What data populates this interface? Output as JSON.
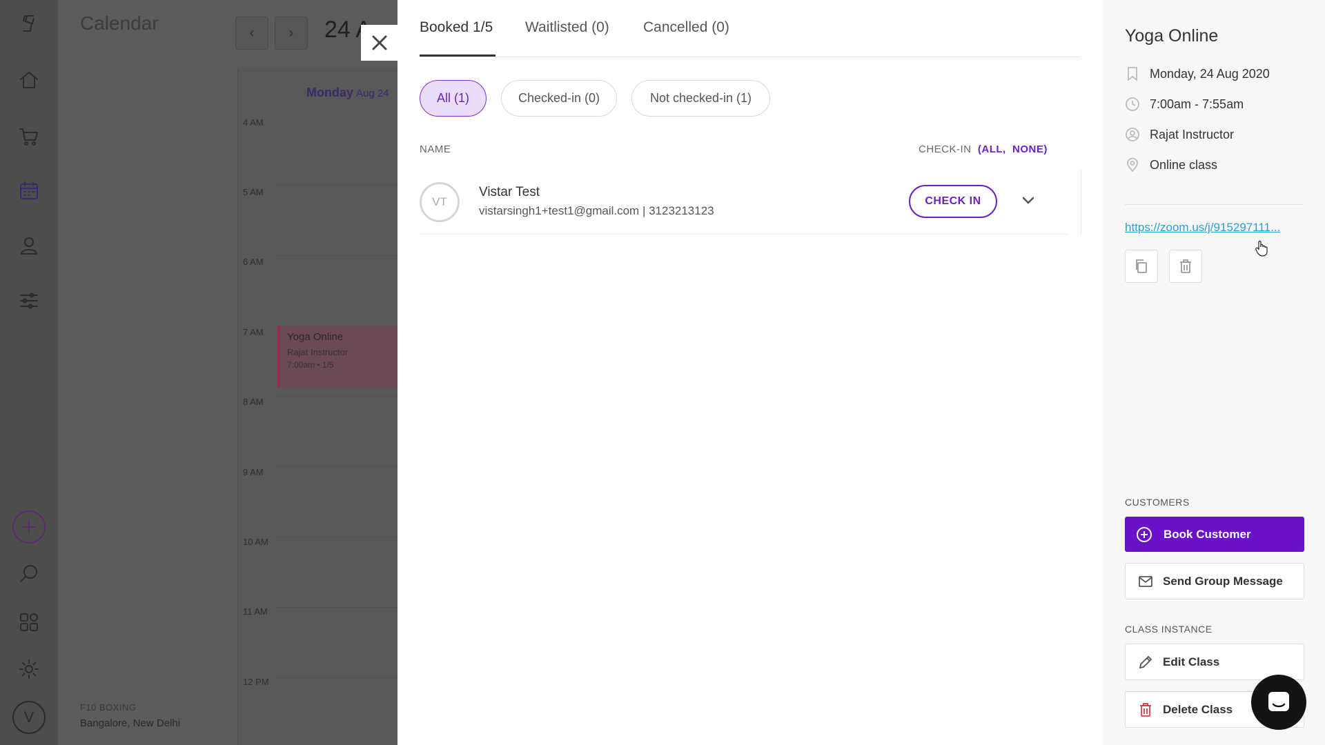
{
  "app": {
    "title": "Calendar"
  },
  "calendar": {
    "date_label": "24 A",
    "day_name": "Monday",
    "day_date": "Aug 24",
    "hours": [
      "4 AM",
      "5 AM",
      "6 AM",
      "7 AM",
      "8 AM",
      "9 AM",
      "10 AM",
      "11 AM",
      "12 PM"
    ],
    "event": {
      "title": "Yoga Online",
      "instructor": "Rajat Instructor",
      "meta": "7:00am • 1/5"
    },
    "org_name": "F10 BOXING",
    "org_location": "Bangalore, New Delhi"
  },
  "nav": {
    "avatar_letter": "V"
  },
  "tabs": [
    {
      "label": "Booked 1/5",
      "active": true
    },
    {
      "label": "Waitlisted (0)",
      "active": false
    },
    {
      "label": "Cancelled (0)",
      "active": false
    }
  ],
  "filters": [
    {
      "label": "All (1)",
      "active": true
    },
    {
      "label": "Checked-in (0)",
      "active": false
    },
    {
      "label": "Not checked-in (1)",
      "active": false
    }
  ],
  "list": {
    "col_name": "NAME",
    "col_checkin": "CHECK-IN",
    "checkin_all": "ALL",
    "checkin_none": "NONE",
    "rows": [
      {
        "initials": "VT",
        "name": "Vistar Test",
        "contact": "vistarsingh1+test1@gmail.com | 3123213123",
        "action": "CHECK IN"
      }
    ]
  },
  "details": {
    "title": "Yoga Online",
    "date": "Monday, 24 Aug 2020",
    "time": "7:00am - 7:55am",
    "instructor": "Rajat Instructor",
    "location": "Online class",
    "link": "https://zoom.us/j/915297111..."
  },
  "customers": {
    "heading": "CUSTOMERS",
    "book_label": "Book Customer",
    "message_label": "Send Group Message"
  },
  "class_instance": {
    "heading": "CLASS INSTANCE",
    "edit_label": "Edit Class",
    "delete_label": "Delete Class"
  },
  "colors": {
    "accent": "#6a12c8",
    "danger": "#d23a4a",
    "link": "#2a9fd8"
  }
}
